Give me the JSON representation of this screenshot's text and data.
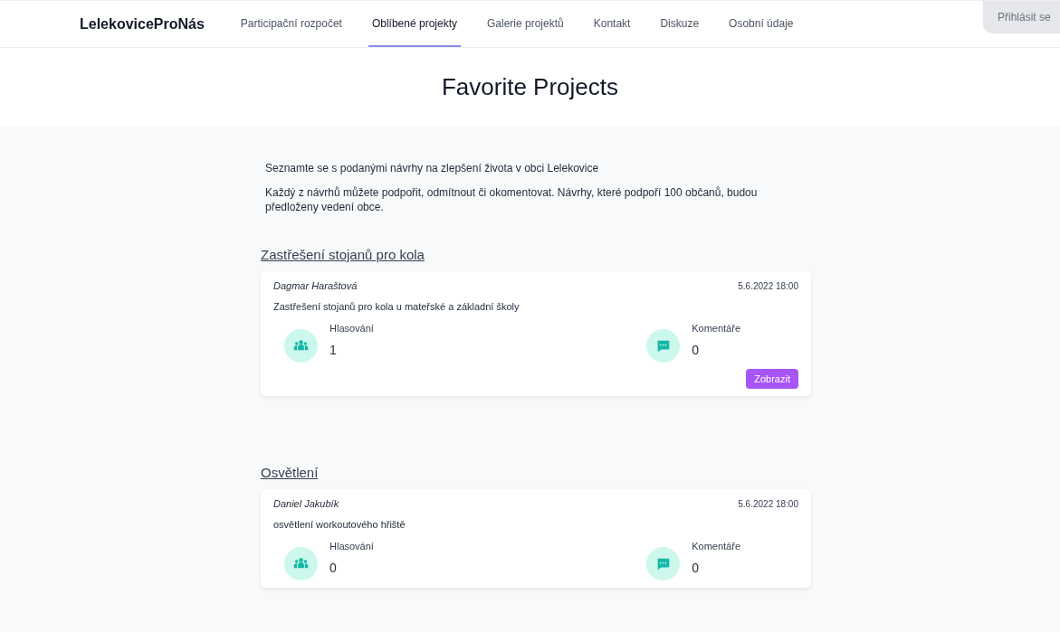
{
  "nav": {
    "logo": "LelekoviceProNás",
    "items": [
      {
        "label": "Participační rozpočet",
        "selected": false
      },
      {
        "label": "Oblíbené projekty",
        "selected": true
      },
      {
        "label": "Galerie projektů",
        "selected": false
      },
      {
        "label": "Kontakt",
        "selected": false
      },
      {
        "label": "Diskuze",
        "selected": false
      },
      {
        "label": "Osobní údaje",
        "selected": false
      }
    ],
    "login_button": "Přihlásit se"
  },
  "page_title": "Favorite Projects",
  "intro": [
    "Seznamte se s podanými návrhy na zlepšení života v obci Lelekovice",
    "Každý z návrhů můžete podpořit, odmítnout či okomentovat. Návrhy, které podpoří 100 občanů, budou předloženy vedení obce."
  ],
  "projects": [
    {
      "title": "Zastřešení stojanů pro kola",
      "author": "Dagmar Haraštová",
      "date": "5.6.2022 18:00",
      "description": "Zastřešení stojanů pro kola u mateřské a základní školy",
      "votes_label": "Hlasování",
      "votes": "1",
      "comments_label": "Komentáře",
      "comments": "0",
      "button": "Zobrazit"
    },
    {
      "title": "Osvětlení",
      "author": "Daniel Jakubík",
      "date": "5.6.2022 18:00",
      "description": "osvětlení workoutového hřiště",
      "votes_label": "Hlasování",
      "votes": "0",
      "comments_label": "Komentáře",
      "comments": "0"
    }
  ]
}
